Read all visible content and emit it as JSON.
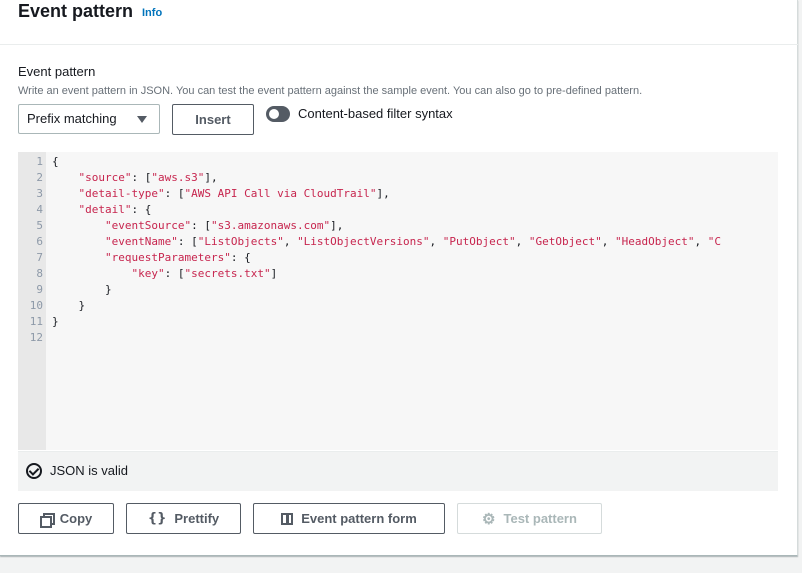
{
  "header": {
    "title": "Event pattern",
    "info": "Info"
  },
  "field": {
    "label": "Event pattern",
    "description": "Write an event pattern in JSON. You can test the event pattern against the sample event. You can also go to pre-defined pattern."
  },
  "controls": {
    "select_value": "Prefix matching",
    "insert_label": "Insert",
    "toggle_label": "Content-based filter syntax"
  },
  "editor": {
    "line_numbers": [
      "1",
      "2",
      "3",
      "4",
      "5",
      "6",
      "7",
      "8",
      "9",
      "10",
      "11",
      "12"
    ],
    "lines": [
      "{",
      "    \"source\": [\"aws.s3\"],",
      "    \"detail-type\": [\"AWS API Call via CloudTrail\"],",
      "    \"detail\": {",
      "        \"eventSource\": [\"s3.amazonaws.com\"],",
      "        \"eventName\": [\"ListObjects\", \"ListObjectVersions\", \"PutObject\", \"GetObject\", \"HeadObject\", \"C",
      "        \"requestParameters\": {",
      "            \"key\": [\"secrets.txt\"]",
      "        }",
      "    }",
      "}",
      ""
    ]
  },
  "status": {
    "text": "JSON is valid"
  },
  "actions": {
    "copy": "Copy",
    "prettify": "Prettify",
    "prettify_icon": "{}",
    "form": "Event pattern form",
    "test": "Test pattern"
  },
  "colors": {
    "link": "#0073bb",
    "string": "#c7254e",
    "disabled": "#aab7b8"
  }
}
